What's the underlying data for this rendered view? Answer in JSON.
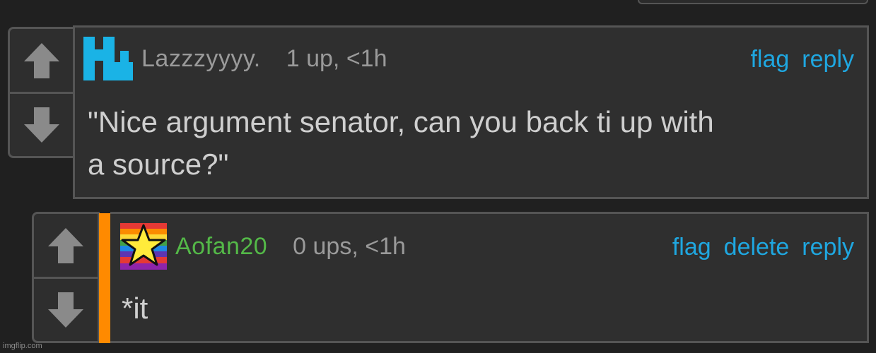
{
  "comments": [
    {
      "username": "Lazzzyyyy.",
      "meta": "1 up, <1h",
      "actions": [
        "flag",
        "reply"
      ],
      "text_lines": [
        "\"Nice argument senator, can you back ti up with",
        "a source?\""
      ],
      "avatar_icon": "blue-pixel-avatar-icon",
      "colors": {
        "avatar": "#1ab3e6",
        "username": "#9a9a9a"
      }
    },
    {
      "username": "Aofan20",
      "meta": "0 ups, <1h",
      "actions": [
        "flag",
        "delete",
        "reply"
      ],
      "text_lines": [
        "*it"
      ],
      "avatar_icon": "rainbow-star-avatar-icon",
      "colors": {
        "username": "#54b948",
        "reply_indicator": "#ff8a00"
      }
    }
  ],
  "vote": {
    "up_icon": "upvote-arrow-icon",
    "down_icon": "downvote-arrow-icon"
  },
  "watermark": "imgflip.com",
  "colors": {
    "background": "#202020",
    "panel": "#2f2f2f",
    "border": "#555555",
    "link": "#1fa7e0",
    "text": "#cfcfcf",
    "muted": "#9a9a9a"
  }
}
